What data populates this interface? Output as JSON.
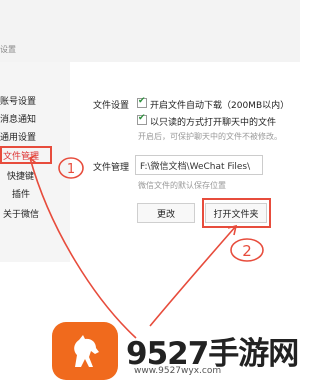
{
  "window": {
    "title": "设置"
  },
  "sidebar": {
    "items": [
      {
        "label": "账号设置"
      },
      {
        "label": "消息通知"
      },
      {
        "label": "通用设置"
      },
      {
        "label": "文件管理"
      },
      {
        "label": "快捷键"
      },
      {
        "label": "插件"
      },
      {
        "label": "关于微信"
      }
    ]
  },
  "file_settings": {
    "section_label": "文件设置",
    "options": [
      {
        "label": "开启文件自动下载（200MB以内）",
        "checked": true
      },
      {
        "label": "以只读的方式打开聊天中的文件",
        "checked": true
      }
    ],
    "hint": "开启后，可保护聊天中的文件不被修改。"
  },
  "file_management": {
    "section_label": "文件管理",
    "path_value": "F:\\微信文档\\WeChat Files\\",
    "hint": "微信文件的默认保存位置",
    "change_button": "更改",
    "open_button": "打开文件夹"
  },
  "annotations": {
    "step1": "1",
    "step2": "2",
    "color": "#e74c3c"
  },
  "watermark": {
    "text": "9527手游网",
    "url": "www.9527wyx.com",
    "logo_color": "#f06a1d",
    "logo_icon": "horse-icon"
  }
}
